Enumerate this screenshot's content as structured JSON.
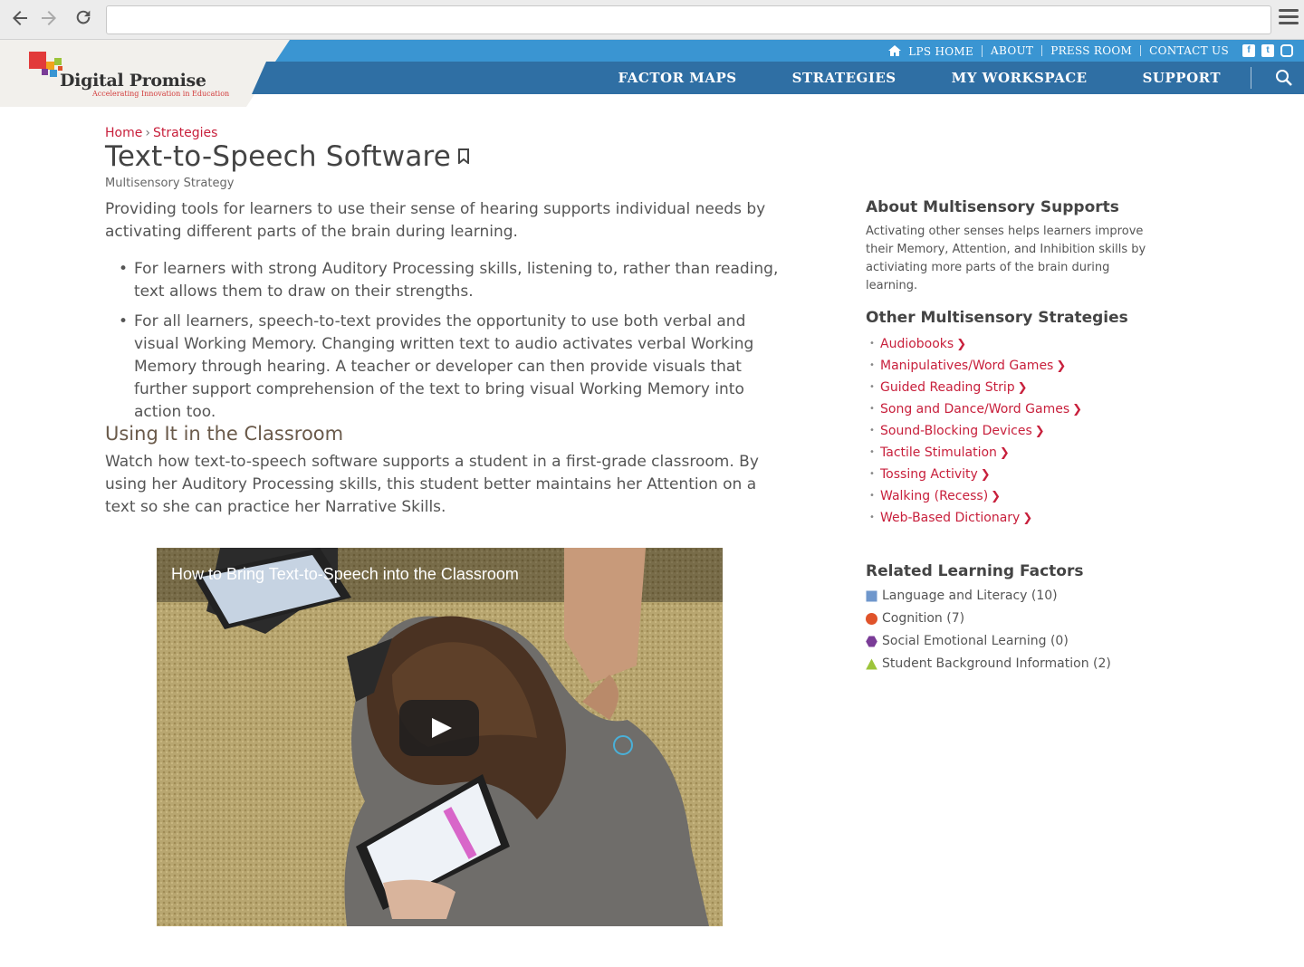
{
  "browser": {
    "back_icon": "arrow-left-icon",
    "forward_icon": "arrow-right-icon",
    "reload_icon": "reload-icon",
    "url": "",
    "menu_icon": "hamburger-menu-icon"
  },
  "logo": {
    "name": "Digital Promise",
    "tagline": "Accelerating Innovation in Education"
  },
  "top_links": [
    "LPS HOME",
    "ABOUT",
    "PRESS ROOM",
    "CONTACT US"
  ],
  "social_icons": [
    "facebook-icon",
    "twitter-icon",
    "instagram-icon"
  ],
  "main_nav": [
    "FACTOR MAPS",
    "STRATEGIES",
    "MY WORKSPACE",
    "SUPPORT"
  ],
  "breadcrumb": {
    "home": "Home",
    "separator": "›",
    "current": "Strategies"
  },
  "page": {
    "title": "Text-to-Speech Software",
    "subtitle": "Multisensory Strategy",
    "intro": "Providing tools for learners to use their sense of hearing supports individual needs by activating different parts of the brain during learning.",
    "bullets": [
      "For learners with strong Auditory Processing skills, listening to, rather than reading, text allows them to draw on their strengths.",
      "For all learners, speech-to-text provides the opportunity to use both verbal and visual Working Memory. Changing written text to audio activates verbal Working Memory through hearing. A teacher or developer can then provide visuals that further support comprehension of the text to bring visual Working Memory into action too."
    ],
    "section_title": "Using It in the Classroom",
    "section_body": "Watch how text-to-speech software supports a student in a first-grade classroom. By using her Auditory Processing skills, this student better maintains her Attention on a text so she can practice her Narrative Skills.",
    "video_title": "How to Bring Text-to-Speech into the Classroom"
  },
  "sidebar": {
    "about_title": "About Multisensory Supports",
    "about_text": "Activating other senses helps learners improve their Memory, Attention, and Inhibition skills by activiating more parts of the brain during learning.",
    "other_title": "Other Multisensory Strategies",
    "strategies": [
      "Audiobooks",
      "Manipulatives/Word Games",
      "Guided Reading Strip",
      "Song and Dance/Word Games",
      "Sound-Blocking Devices",
      "Tactile Stimulation",
      "Tossing Activity",
      "Walking (Recess)",
      "Web-Based Dictionary"
    ],
    "chevron": "❯",
    "factors_title": "Related Learning Factors",
    "factors": [
      {
        "label": "Language and Literacy (10)",
        "shape": "square",
        "color": "#6f97cc"
      },
      {
        "label": "Cognition (7)",
        "shape": "circle",
        "color": "#e0532a"
      },
      {
        "label": "Social Emotional Learning (0)",
        "shape": "hexagon",
        "color": "#7a3c97"
      },
      {
        "label": "Student Background Information (2)",
        "shape": "triangle",
        "color": "#9cc43a"
      }
    ]
  },
  "colors": {
    "top_bar": "#3a95d2",
    "main_bar": "#2f6fa4",
    "link": "#c8203c",
    "logo_bg": "#f2f0ec"
  }
}
